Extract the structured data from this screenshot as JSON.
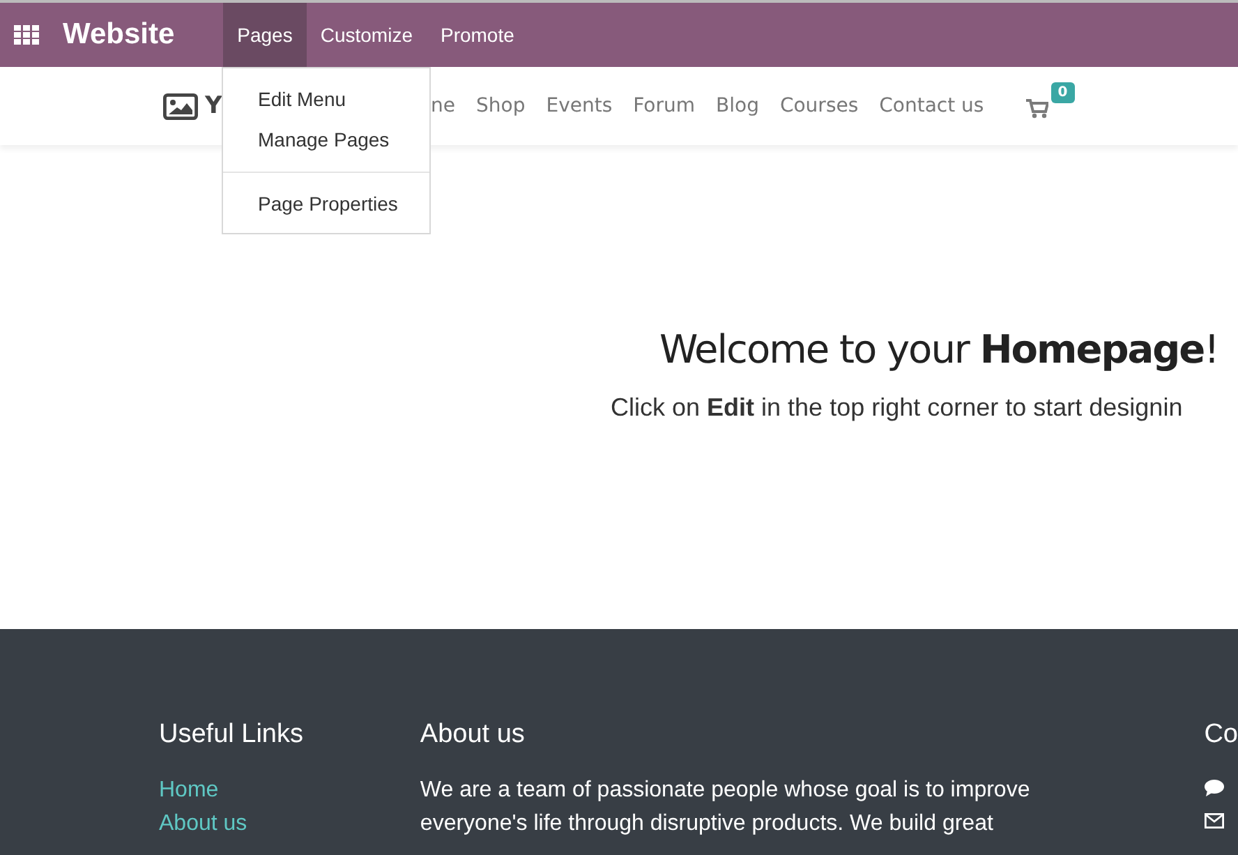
{
  "topbar": {
    "app_title": "Website",
    "menus": [
      {
        "label": "Pages",
        "selected": true
      },
      {
        "label": "Customize",
        "selected": false
      },
      {
        "label": "Promote",
        "selected": false
      }
    ]
  },
  "dropdown": {
    "items": [
      {
        "label": "Edit Menu",
        "kind": "item"
      },
      {
        "label": "Manage Pages",
        "kind": "item"
      },
      {
        "kind": "divider"
      },
      {
        "label": "Page Properties",
        "kind": "item"
      }
    ]
  },
  "navbar": {
    "logo_text": "Y",
    "links": [
      "ne",
      "Shop",
      "Events",
      "Forum",
      "Blog",
      "Courses",
      "Contact us"
    ],
    "cart_count": "0"
  },
  "hero": {
    "title": "Welcome to your **Homepage**!",
    "subtitle": "Click on **Edit** in the top right corner to start designin"
  },
  "footer": {
    "columns": [
      {
        "kind": "links",
        "title": "Useful Links",
        "items": [
          "Home",
          "About us"
        ]
      },
      {
        "kind": "text",
        "title": "About us",
        "lines": [
          "We are a team of passionate people whose goal is to improve",
          "everyone's life through disruptive products. We build great"
        ]
      },
      {
        "kind": "contact",
        "title": "Co"
      }
    ]
  }
}
